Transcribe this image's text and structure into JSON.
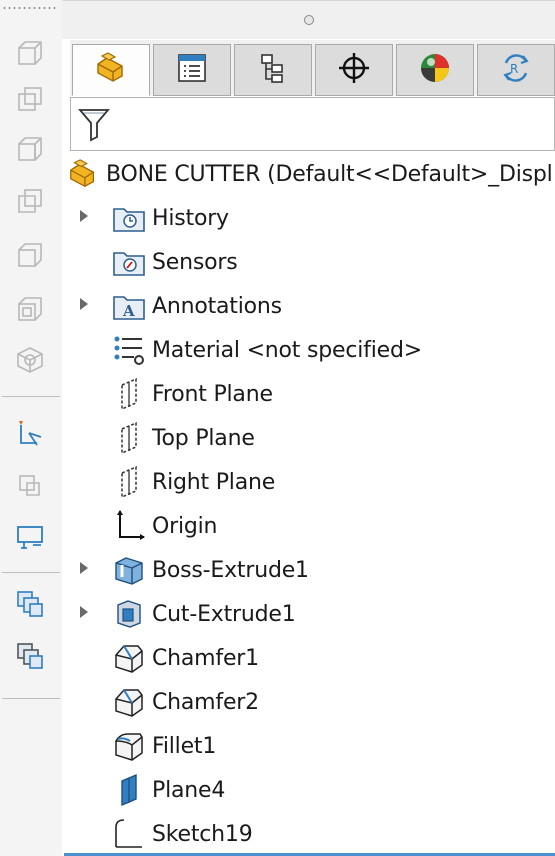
{
  "tabs": [
    {
      "name": "featuremanager",
      "icon": "featuremanager-tab-icon",
      "active": true
    },
    {
      "name": "propertymanager",
      "icon": "propertymanager-tab-icon"
    },
    {
      "name": "configurationmanager",
      "icon": "configurationmanager-tab-icon"
    },
    {
      "name": "dimxpertmanager",
      "icon": "dimxpertmanager-tab-icon"
    },
    {
      "name": "displaymanager",
      "icon": "displaymanager-tab-icon"
    },
    {
      "name": "cam",
      "icon": "cam-tab-icon"
    }
  ],
  "tree": {
    "root": {
      "label": "BONE CUTTER  (Default<<Default>_Displ",
      "icon": "part-icon"
    },
    "items": [
      {
        "label": "History",
        "icon": "history-folder-icon",
        "expandable": true
      },
      {
        "label": "Sensors",
        "icon": "sensors-folder-icon",
        "expandable": false
      },
      {
        "label": "Annotations",
        "icon": "annotations-folder-icon",
        "expandable": true
      },
      {
        "label": "Material <not specified>",
        "icon": "material-icon",
        "expandable": false
      },
      {
        "label": "Front Plane",
        "icon": "plane-icon",
        "expandable": false
      },
      {
        "label": "Top Plane",
        "icon": "plane-icon",
        "expandable": false
      },
      {
        "label": "Right Plane",
        "icon": "plane-icon",
        "expandable": false
      },
      {
        "label": "Origin",
        "icon": "origin-icon",
        "expandable": false
      },
      {
        "label": "Boss-Extrude1",
        "icon": "boss-extrude-icon",
        "expandable": true
      },
      {
        "label": "Cut-Extrude1",
        "icon": "cut-extrude-icon",
        "expandable": true
      },
      {
        "label": "Chamfer1",
        "icon": "chamfer-icon",
        "expandable": false
      },
      {
        "label": "Chamfer2",
        "icon": "chamfer-icon",
        "expandable": false
      },
      {
        "label": "Fillet1",
        "icon": "fillet-icon",
        "expandable": false
      },
      {
        "label": "Plane4",
        "icon": "solid-plane-icon",
        "expandable": false
      },
      {
        "label": "Sketch19",
        "icon": "sketch-icon",
        "expandable": false
      }
    ]
  },
  "colors": {
    "accent": "#4a8fcf",
    "part_yellow": "#f2b423",
    "icon_blue": "#2f7fc1"
  }
}
